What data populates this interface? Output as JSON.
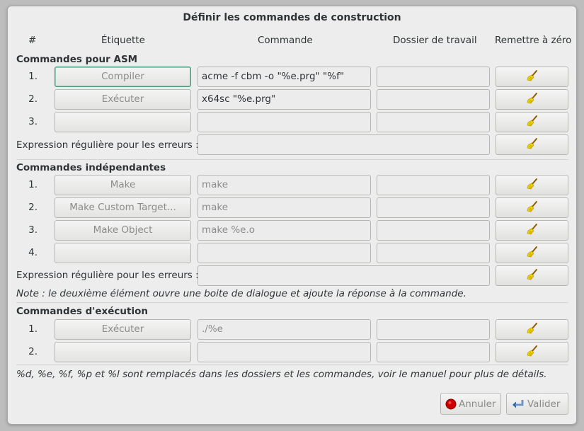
{
  "window": {
    "title": "Définir les commandes de construction"
  },
  "headers": {
    "num": "#",
    "label": "Étiquette",
    "command": "Commande",
    "workdir": "Dossier de travail",
    "reset": "Remettre à zéro"
  },
  "asm": {
    "title": "Commandes pour ASM",
    "rows": [
      {
        "num": "1.",
        "label": "Compiler",
        "command": "acme -f cbm -o \"%e.prg\" \"%f\"",
        "dir": ""
      },
      {
        "num": "2.",
        "label": "Exécuter",
        "command": "x64sc \"%e.prg\"",
        "dir": ""
      },
      {
        "num": "3.",
        "label": "",
        "command": "",
        "dir": ""
      }
    ],
    "regex_label": "Expression régulière pour les erreurs :",
    "regex_value": ""
  },
  "independent": {
    "title": "Commandes indépendantes",
    "rows": [
      {
        "num": "1.",
        "label": "Make",
        "command": "make",
        "dir": ""
      },
      {
        "num": "2.",
        "label": "Make Custom Target...",
        "command": "make",
        "dir": ""
      },
      {
        "num": "3.",
        "label": "Make Object",
        "command": "make %e.o",
        "dir": ""
      },
      {
        "num": "4.",
        "label": "",
        "command": "",
        "dir": ""
      }
    ],
    "regex_label": "Expression régulière pour les erreurs :",
    "regex_value": "",
    "note": "Note : le deuxième élément ouvre une boite de dialogue et ajoute la réponse à la commande."
  },
  "execute": {
    "title": "Commandes d'exécution",
    "rows": [
      {
        "num": "1.",
        "label": "Exécuter",
        "command": "./%e",
        "dir": ""
      },
      {
        "num": "2.",
        "label": "",
        "command": "",
        "dir": ""
      }
    ]
  },
  "footer_note": "%d, %e, %f, %p et %l sont remplacés dans les dossiers et les commandes, voir le manuel pour plus de détails.",
  "buttons": {
    "cancel": "Annuler",
    "ok": "Valider"
  },
  "icons": {
    "reset": "broom-icon",
    "cancel": "stop-circle-icon",
    "ok": "enter-arrow-icon"
  }
}
